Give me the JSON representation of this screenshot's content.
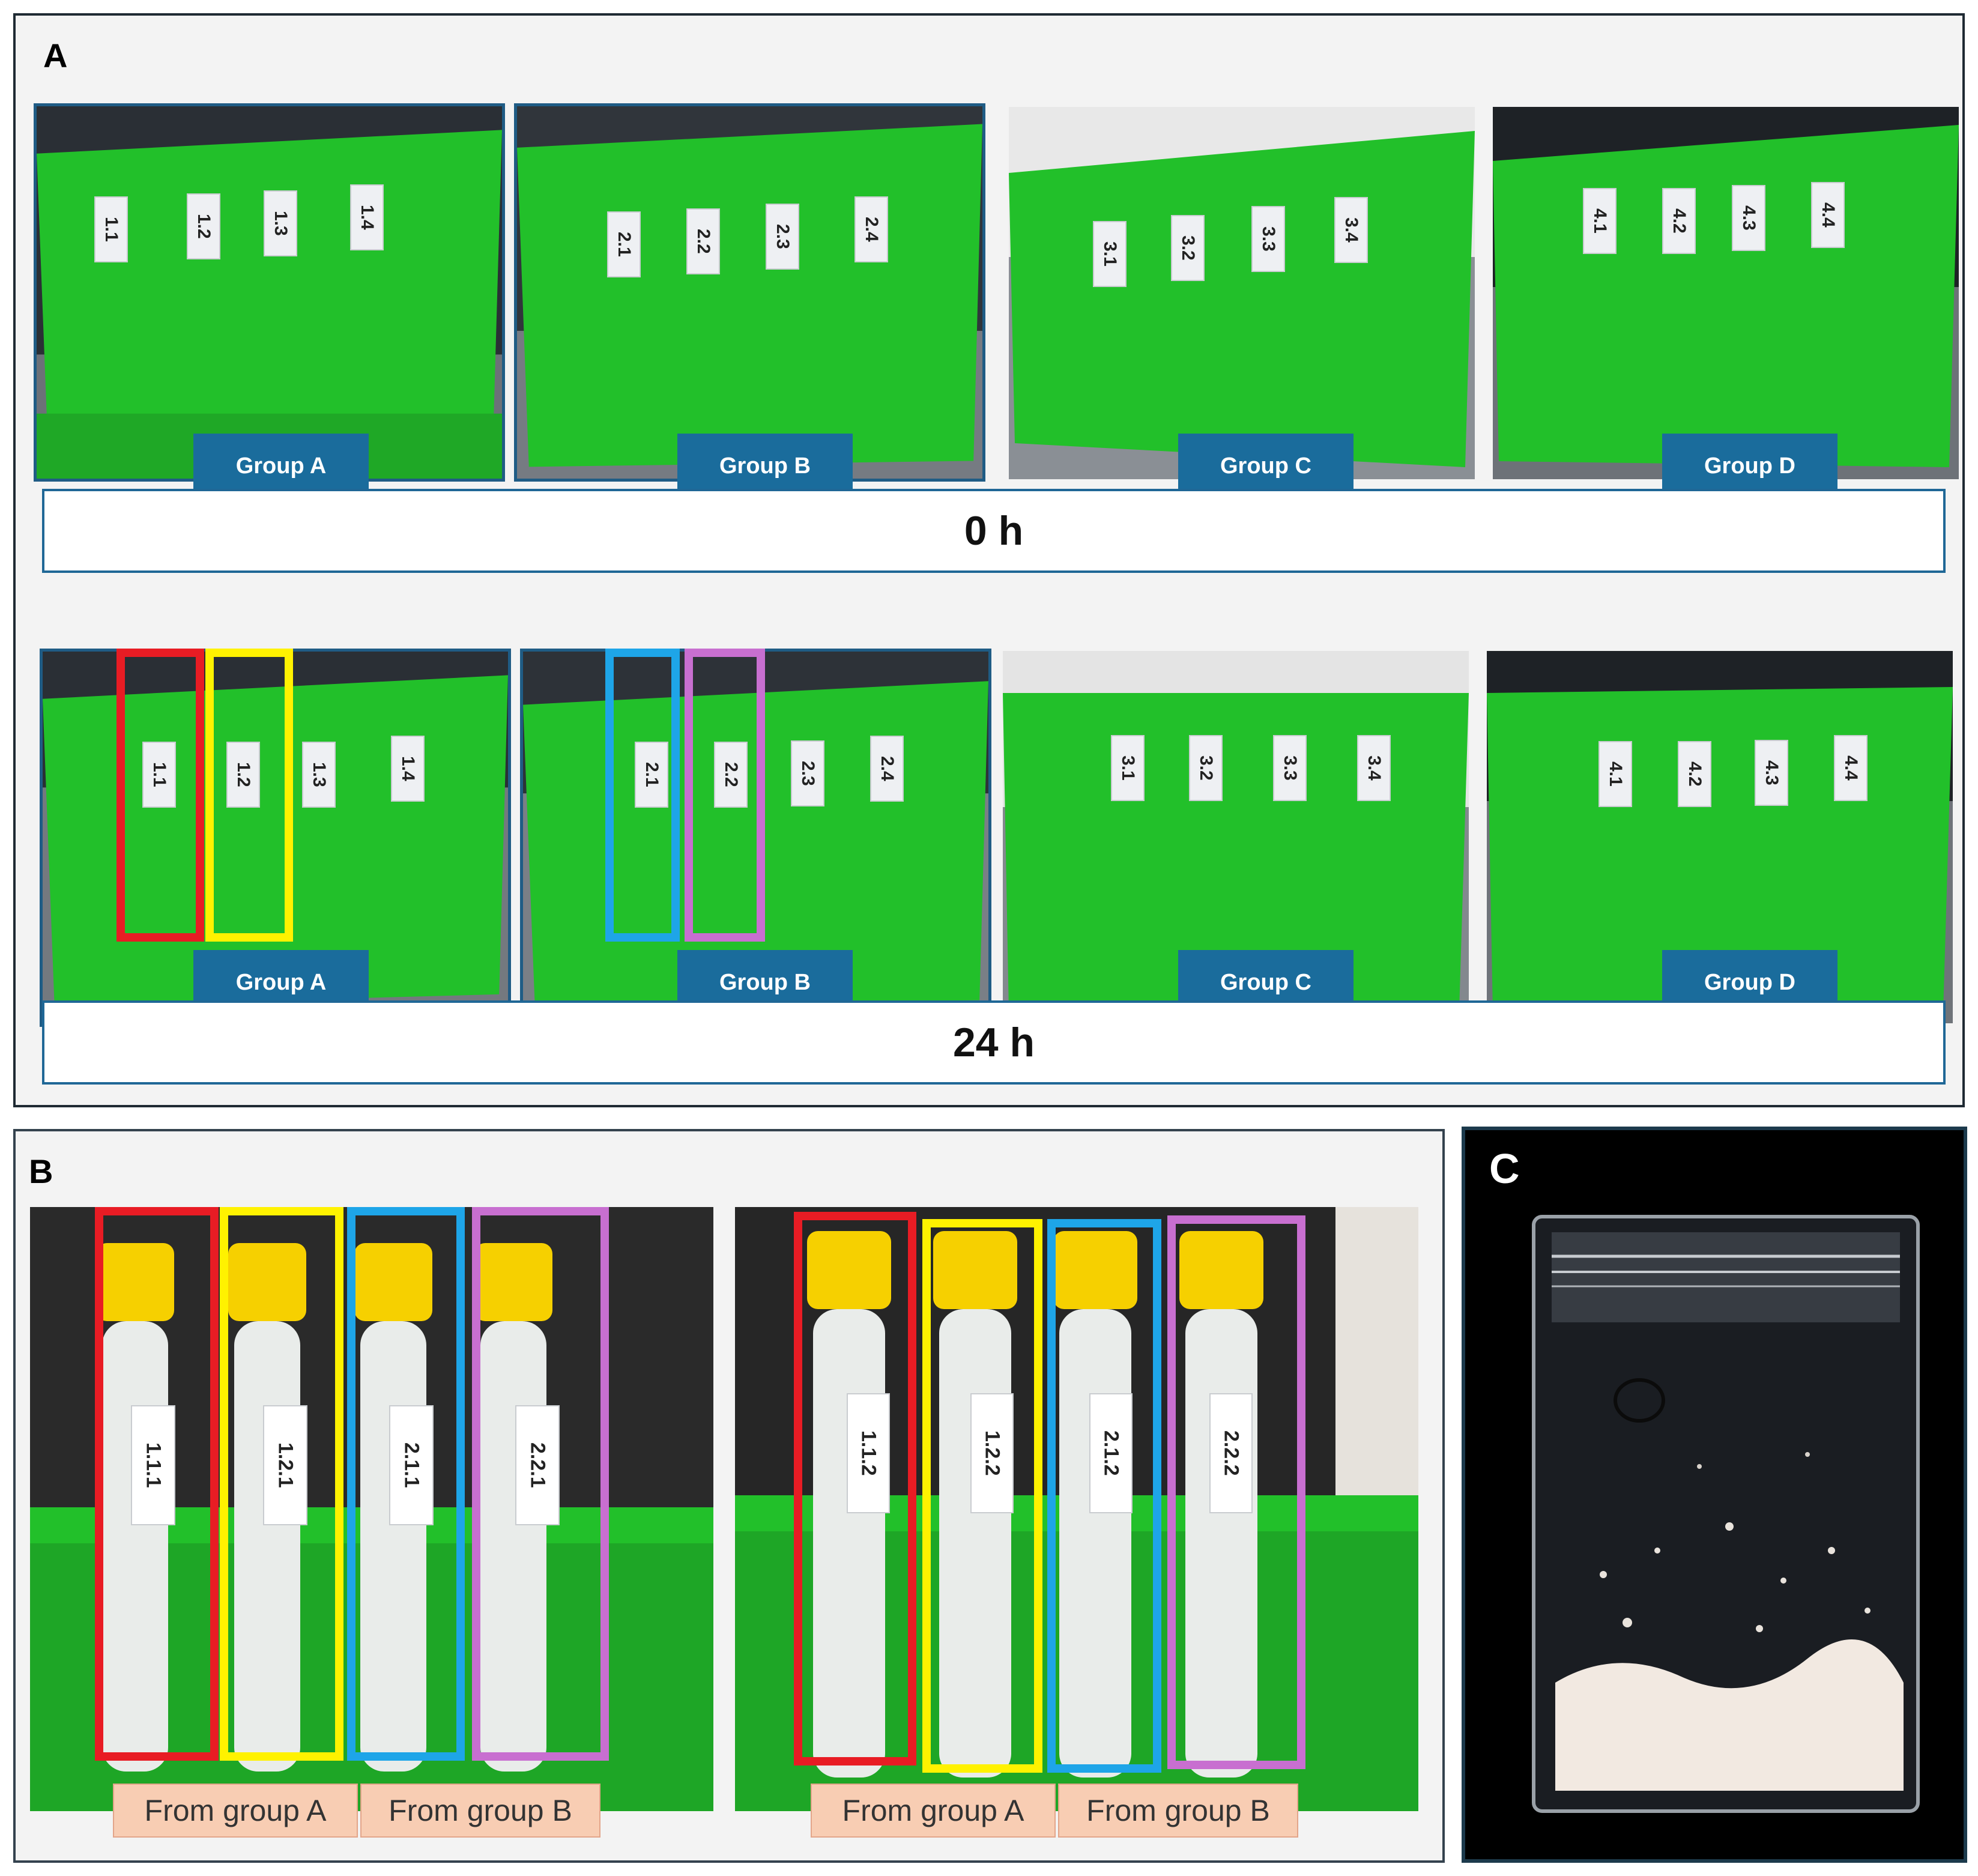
{
  "panels": {
    "a": "A",
    "b": "B",
    "c": "C"
  },
  "panel_a": {
    "row_0h": {
      "time_label": "0 h",
      "groups": [
        {
          "name": "Group A",
          "tubes": [
            "1.1",
            "1.2",
            "1.3",
            "1.4"
          ]
        },
        {
          "name": "Group B",
          "tubes": [
            "2.1",
            "2.2",
            "2.3",
            "2.4"
          ]
        },
        {
          "name": "Group C",
          "tubes": [
            "3.1",
            "3.2",
            "3.3",
            "3.4"
          ]
        },
        {
          "name": "Group D",
          "tubes": [
            "4.1",
            "4.2",
            "4.3",
            "4.4"
          ]
        }
      ]
    },
    "row_24h": {
      "time_label": "24 h",
      "groups": [
        {
          "name": "Group A",
          "tubes": [
            "1.1",
            "1.2",
            "1.3",
            "1.4"
          ]
        },
        {
          "name": "Group B",
          "tubes": [
            "2.1",
            "2.2",
            "2.3",
            "2.4"
          ]
        },
        {
          "name": "Group C",
          "tubes": [
            "3.1",
            "3.2",
            "3.3",
            "3.4"
          ]
        },
        {
          "name": "Group D",
          "tubes": [
            "4.1",
            "4.2",
            "4.3",
            "4.4"
          ]
        }
      ]
    }
  },
  "panel_b": {
    "photos": [
      {
        "tubes": [
          "1.1.1",
          "1.2.1",
          "2.1.1",
          "2.2.1"
        ],
        "source_a": "From group A",
        "source_b": "From group B"
      },
      {
        "tubes": [
          "1.1.2",
          "1.2.2",
          "2.1.2",
          "2.2.2"
        ],
        "source_a": "From group A",
        "source_b": "From group B"
      }
    ]
  },
  "colors": {
    "highlight_1": "#e81c24",
    "highlight_2": "#fff200",
    "highlight_3": "#1ea5e8",
    "highlight_4": "#c86fd0",
    "group_tag": "#1a6c9c",
    "rack_green": "#22c02a"
  }
}
